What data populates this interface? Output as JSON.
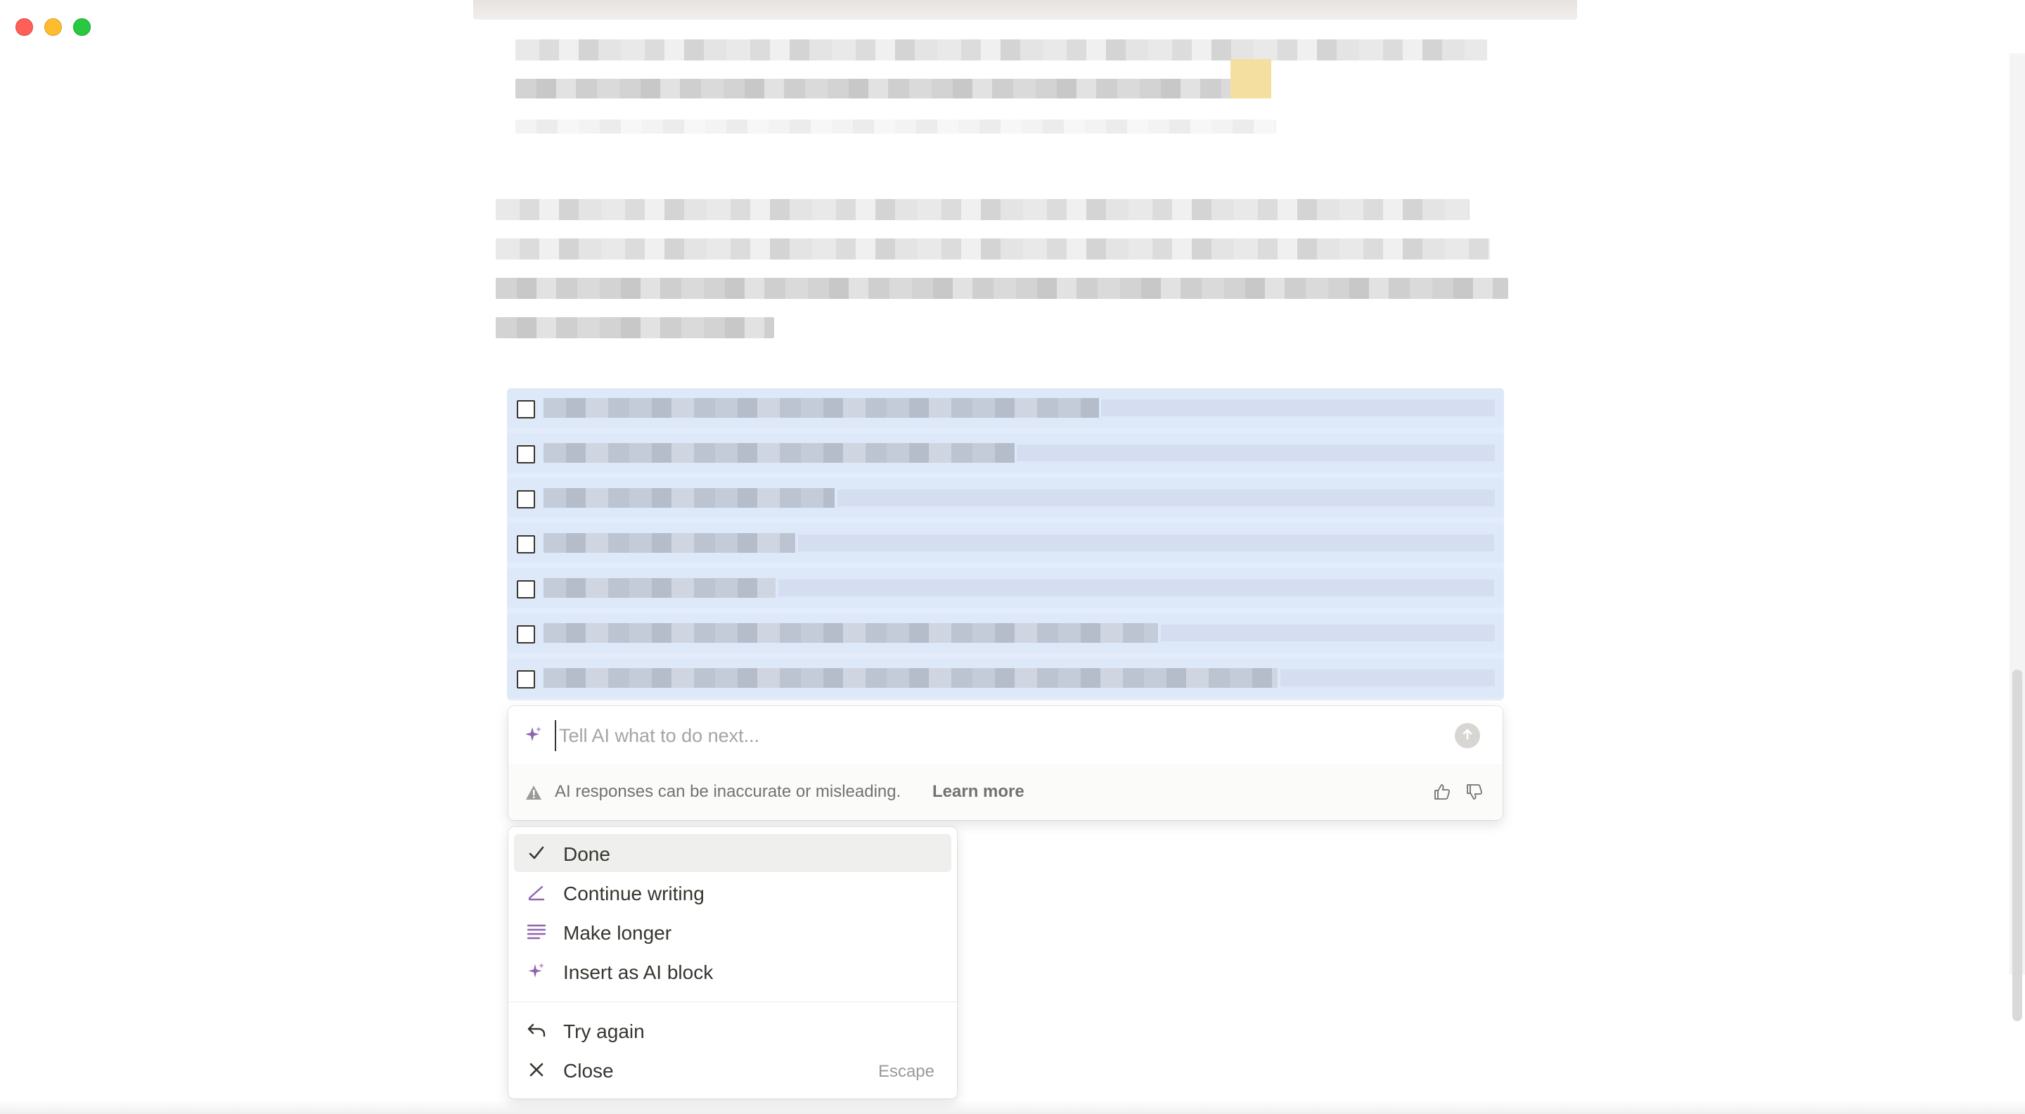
{
  "ai_prompt": {
    "placeholder": "Tell AI what to do next...",
    "disclaimer": "AI responses can be inaccurate or misleading.",
    "learn_more": "Learn more",
    "icons": [
      "sparkle-icon",
      "send-arrow-icon",
      "warning-icon",
      "thumbs-up-icon",
      "thumbs-down-icon"
    ]
  },
  "menu": {
    "primary_items": [
      {
        "label": "Done",
        "icon": "checkmark-icon",
        "selected": true
      },
      {
        "label": "Continue writing",
        "icon": "pencil-icon"
      },
      {
        "label": "Make longer",
        "icon": "lines-icon"
      },
      {
        "label": "Insert as AI block",
        "icon": "sparkle-icon"
      }
    ],
    "secondary_items": [
      {
        "label": "Try again",
        "icon": "undo-arrow-icon"
      },
      {
        "label": "Close",
        "icon": "close-icon",
        "shortcut": "Escape"
      }
    ]
  },
  "todo_list": {
    "count": 7,
    "checked": [
      false,
      false,
      false,
      false,
      false,
      false,
      false
    ]
  },
  "colors": {
    "accent_purple": "#9065b0",
    "selection_blue": "#dde8f8",
    "menu_hover": "#efefee",
    "text": "#37352f",
    "muted_text": "#73726e"
  }
}
